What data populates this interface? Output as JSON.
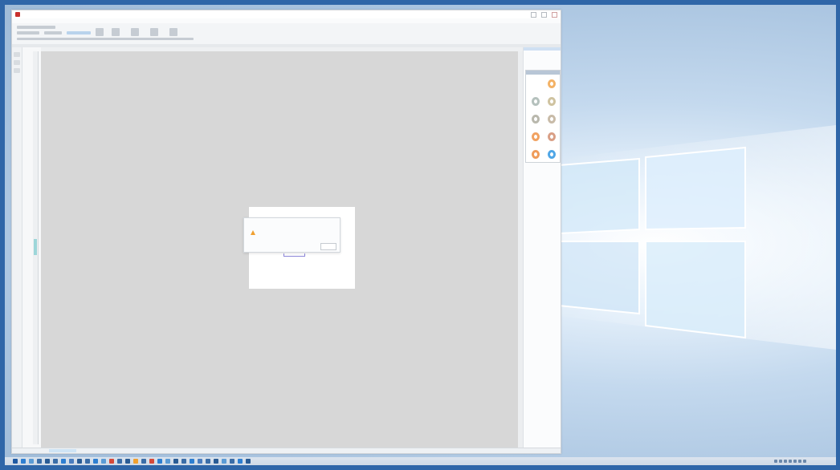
{
  "app": {
    "title": "",
    "menu_text": "",
    "ribbon_labels": [
      "",
      "",
      "",
      "",
      "",
      ""
    ],
    "status_text": ""
  },
  "panel": {
    "title": "",
    "ring_colors": [
      "#ffffff",
      "#f3b266",
      "#b5c1bd",
      "#cfc3a0",
      "#b9b8ad",
      "#c8bba8",
      "#f1a261",
      "#d99f86",
      "#ef9c5a",
      "#4fa6e6",
      "#b8c3cf",
      "#d79a83"
    ]
  },
  "dialog": {
    "title": "",
    "message": "",
    "ok_label": ""
  },
  "taskbar": {
    "icon_colors": [
      "#1f5aa3",
      "#2e7fd1",
      "#5b9bd5",
      "#3b6ea8",
      "#2a5c95",
      "#3b6ea8",
      "#2e7fd1",
      "#4a7dbf",
      "#2a5c95",
      "#3b6ea8",
      "#2e7fd1",
      "#5b9bd5",
      "#d64a3a",
      "#3b6ea8",
      "#2a5c95",
      "#f0a030",
      "#3b6ea8",
      "#d64a3a",
      "#2e7fd1",
      "#5b9bd5",
      "#2a5c95",
      "#3b6ea8",
      "#2e7fd1",
      "#4a7dbf",
      "#3b6ea8",
      "#2a5c95",
      "#5b9bd5",
      "#3b6ea8",
      "#2e7fd1",
      "#2a5c95"
    ],
    "clock": ""
  }
}
